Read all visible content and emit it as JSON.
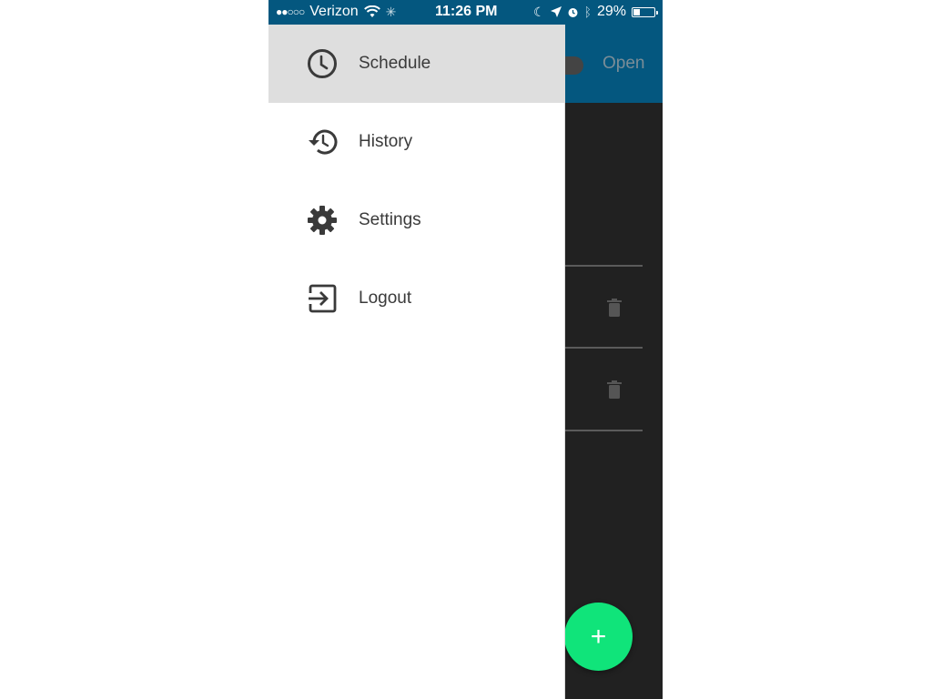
{
  "statusbar": {
    "signal_dots": "●●○○○",
    "carrier": "Verizon",
    "time": "11:26 PM",
    "battery_percent_label": "29%",
    "battery_level": 0.29,
    "icons": [
      "wifi-icon",
      "activity-spinner-icon",
      "moon-icon",
      "location-arrow-icon",
      "alarm-icon",
      "bluetooth-icon",
      "battery-icon"
    ]
  },
  "appbar": {
    "toggle_label": "Open",
    "toggle_on": false
  },
  "drawer": {
    "items": [
      {
        "label": "Schedule",
        "icon": "clock-icon",
        "active": true
      },
      {
        "label": "History",
        "icon": "history-icon",
        "active": false
      },
      {
        "label": "Settings",
        "icon": "gear-icon",
        "active": false
      },
      {
        "label": "Logout",
        "icon": "logout-icon",
        "active": false
      }
    ]
  },
  "content": {
    "list_items": [
      {
        "action_icon": "trash-icon"
      },
      {
        "action_icon": "trash-icon"
      }
    ]
  },
  "fab": {
    "icon": "plus-icon",
    "symbol": "+",
    "color": "#10e47a"
  },
  "colors": {
    "primary": "#04577f",
    "background_dark": "#212121",
    "drawer_active": "#dedede",
    "accent": "#10e47a"
  }
}
